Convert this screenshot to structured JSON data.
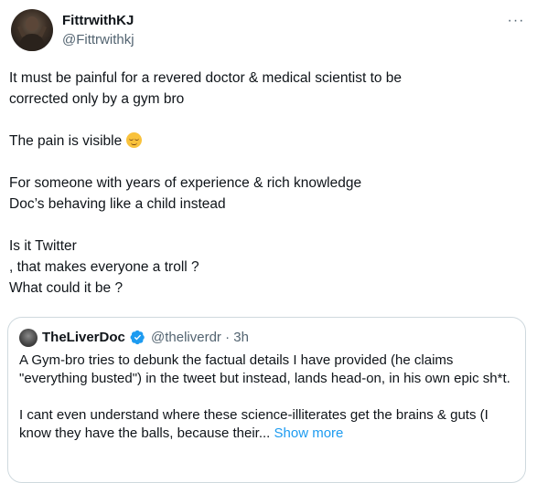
{
  "author": {
    "name": "FittrwithKJ",
    "handle": "@Fittrwithkj",
    "avatar_icon": "user-avatar"
  },
  "menu": {
    "icon": "more-horizontal-icon",
    "label": "···"
  },
  "tweet": {
    "lines": [
      "It must be painful for a revered doctor & medical scientist to be",
      "corrected only by a gym bro",
      "The pain is visible",
      "For someone with years of experience & rich knowledge",
      "Doc’s behaving like a child instead",
      "Is it Twitter",
      ", that makes everyone a troll ?",
      "What could it be ?"
    ],
    "emoji": "relieved-face-emoji"
  },
  "quoted": {
    "name": "TheLiverDoc",
    "verified_icon": "verified-badge-icon",
    "handle_time": "@theliverdr · 3h",
    "paragraph1": "A Gym-bro tries to debunk the factual details I have provided (he claims \"everything busted\") in the tweet but instead, lands head-on, in his own epic sh*t.",
    "paragraph2": "I cant even understand where these science-illiterates get the brains & guts (I know they have the balls, because their...",
    "show_more": "Show more"
  },
  "colors": {
    "text": "#0f1419",
    "secondary": "#536471",
    "link": "#1d9bf0",
    "border": "#cfd9de"
  }
}
